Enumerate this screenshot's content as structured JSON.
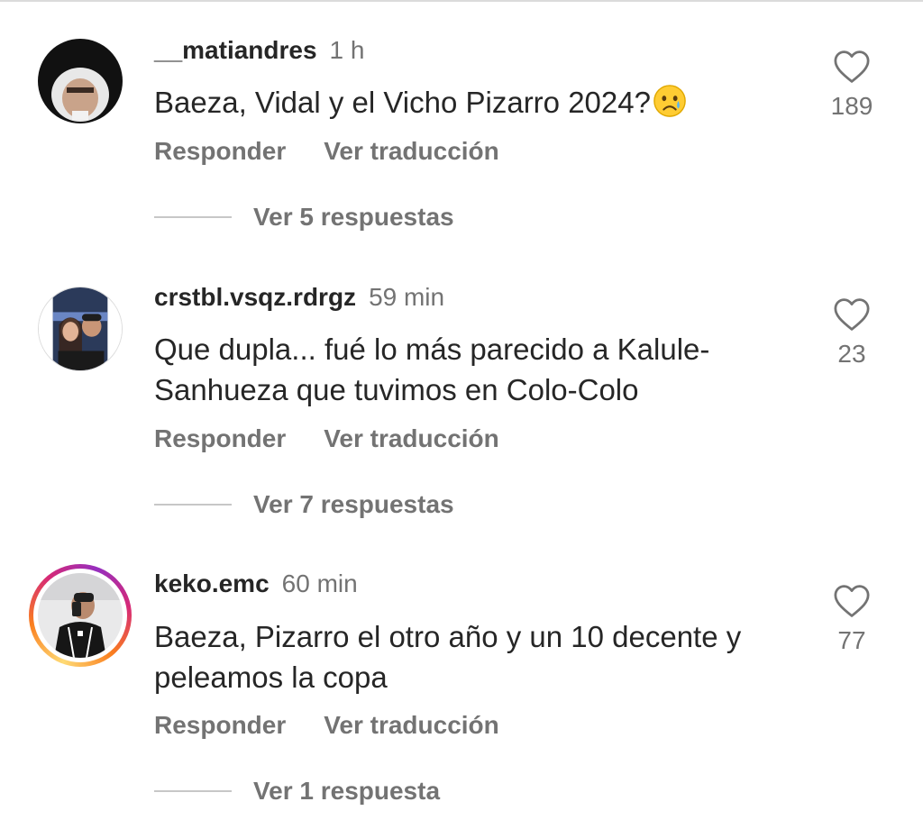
{
  "comments": [
    {
      "username": "__matiandres",
      "time": "1 h",
      "text": "Baeza, Vidal y el Vicho Pizarro 2024?",
      "emoji": "crying-face",
      "reply_label": "Responder",
      "translate_label": "Ver traducción",
      "replies_label": "Ver 5 respuestas",
      "likes": "189",
      "has_story": false
    },
    {
      "username": "crstbl.vsqz.rdrgz",
      "time": "59 min",
      "text": "Que dupla... fué lo más parecido a Kalule-Sanhueza que tuvimos en Colo-Colo",
      "reply_label": "Responder",
      "translate_label": "Ver traducción",
      "replies_label": "Ver 7 respuestas",
      "likes": "23",
      "has_story": false
    },
    {
      "username": "keko.emc",
      "time": "60 min",
      "text": "Baeza, Pizarro el otro año y un 10 decente y peleamos la copa",
      "reply_label": "Responder",
      "translate_label": "Ver traducción",
      "replies_label": "Ver 1 respuesta",
      "likes": "77",
      "has_story": true
    }
  ],
  "icons": {
    "like": "heart-outline-icon"
  },
  "colors": {
    "text": "#262626",
    "secondary": "#737373",
    "divider": "#c7c7c7"
  }
}
